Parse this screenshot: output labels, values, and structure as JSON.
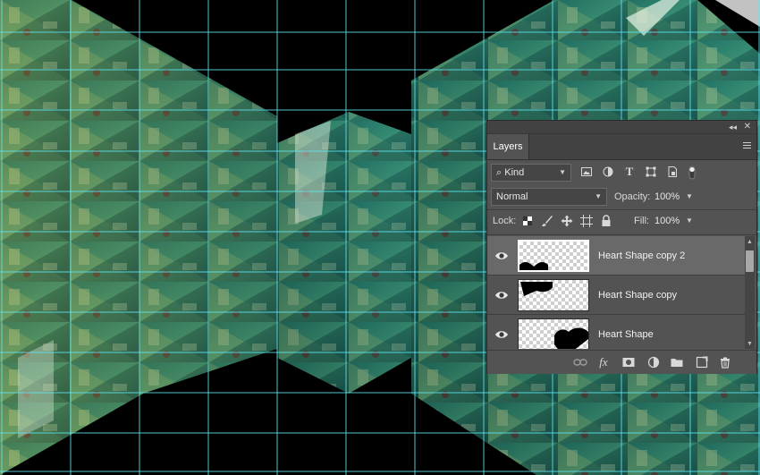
{
  "panel": {
    "collapse_glyph": "◂◂",
    "close_glyph": "✕",
    "tab_label": "Layers"
  },
  "filter": {
    "search_glyph": "⌕",
    "kind_label": "Kind",
    "icons": [
      "image-filter-icon",
      "adjustment-filter-icon",
      "type-filter-icon",
      "shape-filter-icon",
      "smart-object-filter-icon",
      "filter-toggle-icon"
    ]
  },
  "blend": {
    "mode": "Normal",
    "opacity_label": "Opacity:",
    "opacity_value": "100%"
  },
  "lock": {
    "label": "Lock:",
    "fill_label": "Fill:",
    "fill_value": "100%"
  },
  "layers": [
    {
      "name": "Heart Shape copy 2",
      "selected": true
    },
    {
      "name": "Heart Shape copy",
      "selected": false
    },
    {
      "name": "Heart Shape",
      "selected": false
    }
  ],
  "footer_icons": [
    "link-layers-icon",
    "fx-icon",
    "mask-icon",
    "adjustment-layer-icon",
    "group-folder-icon",
    "new-layer-icon",
    "trash-icon"
  ],
  "footer": {
    "fx_glyph": "fx",
    "trash_glyph": "🗑"
  },
  "colors": {
    "guide": "#5fe6f2",
    "panel_bg": "#535353",
    "panel_dark": "#424242",
    "selected_row": "#696969"
  }
}
